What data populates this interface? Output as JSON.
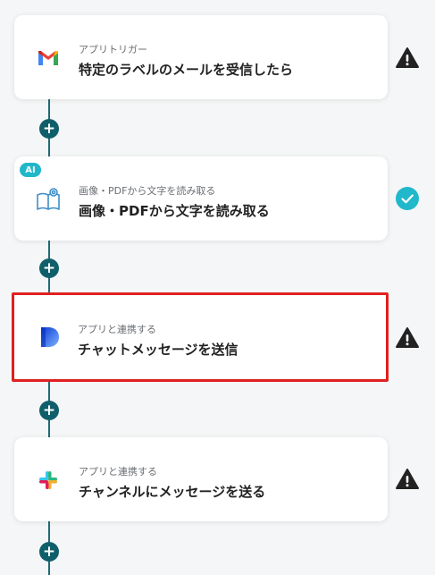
{
  "steps": [
    {
      "subtitle": "アプリトリガー",
      "title": "特定のラベルのメールを受信したら",
      "icon": "gmail-icon",
      "status": "warning"
    },
    {
      "subtitle": "画像・PDFから文字を読み取る",
      "title": "画像・PDFから文字を読み取る",
      "icon": "ocr-book-icon",
      "badge": "AI",
      "status": "complete"
    },
    {
      "subtitle": "アプリと連携する",
      "title": "チャットメッセージを送信",
      "icon": "chat-app-d-icon",
      "status": "warning",
      "selected": true
    },
    {
      "subtitle": "アプリと連携する",
      "title": "チャンネルにメッセージを送る",
      "icon": "slack-icon",
      "status": "warning"
    }
  ],
  "add_button_label": "+",
  "colors": {
    "connector": "#1f6b74",
    "add_button": "#0f5f6b",
    "ai_badge": "#20b7c9",
    "complete": "#21b8cb",
    "warning": "#222222",
    "selected_border": "#e0201f"
  }
}
